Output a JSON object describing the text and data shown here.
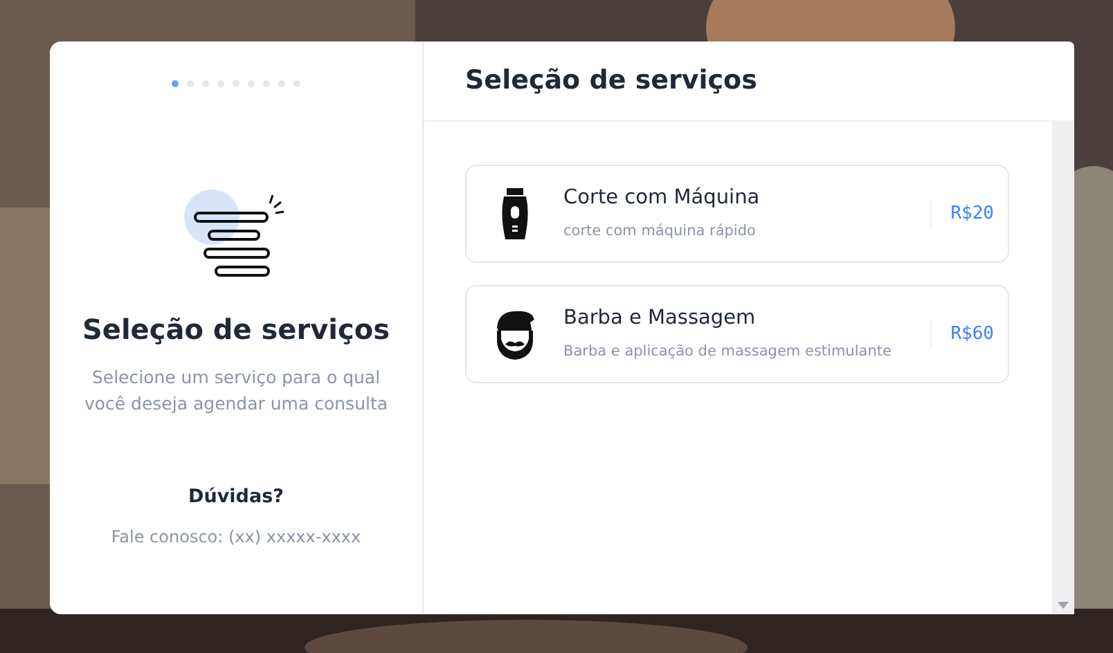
{
  "steps": [
    {
      "selected": true
    },
    {
      "selected": false
    },
    {
      "selected": false
    },
    {
      "selected": false
    },
    {
      "selected": false
    },
    {
      "selected": false
    },
    {
      "selected": false
    },
    {
      "selected": false
    },
    {
      "selected": false
    }
  ],
  "sidebar": {
    "title": "Seleção de serviços",
    "description": "Selecione um serviço para o qual você deseja agendar uma consulta",
    "help_title": "Dúvidas?",
    "help_text": "Fale conosco: (xx) xxxxx-xxxx"
  },
  "panel": {
    "title": "Seleção de serviços"
  },
  "services": [
    {
      "kind": "clipper",
      "name": "Corte com Máquina",
      "description": "corte com máquina rápido",
      "price": "R$20"
    },
    {
      "kind": "beard",
      "name": "Barba e Massagem",
      "description": "Barba e aplicação de massagem estimulante",
      "price": "R$60"
    }
  ]
}
